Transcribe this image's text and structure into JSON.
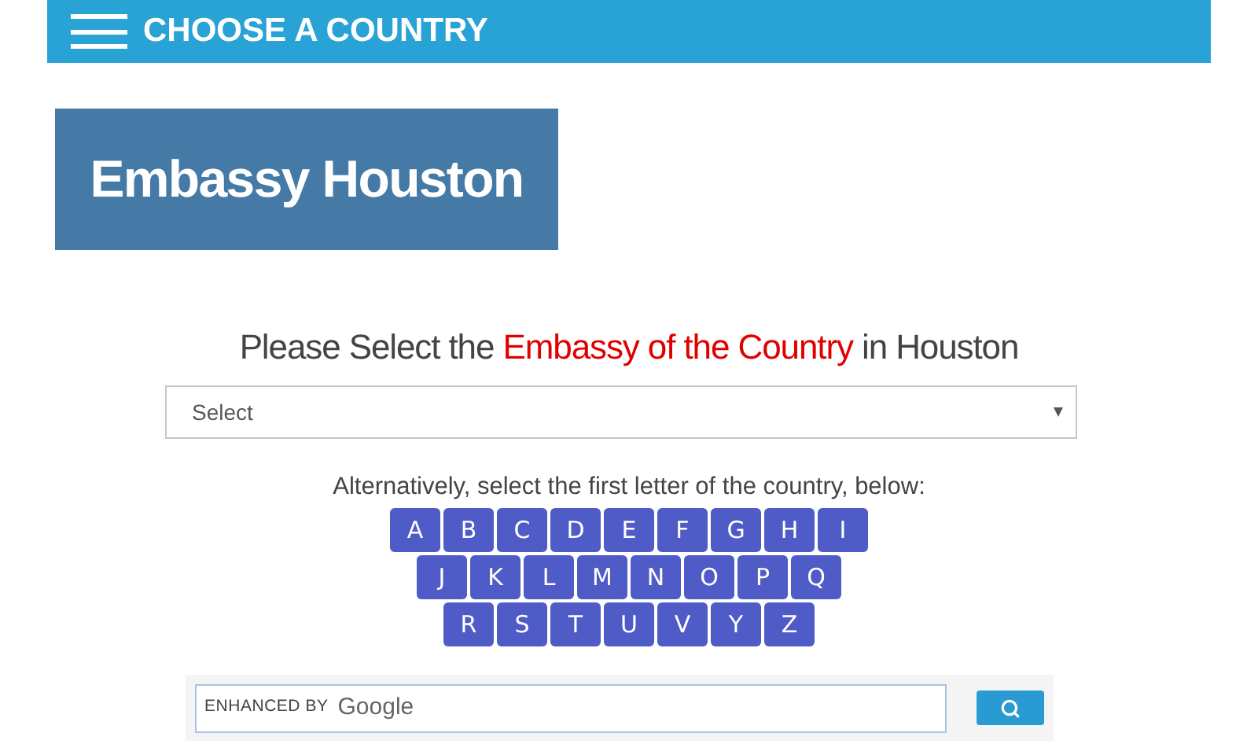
{
  "header": {
    "title": "CHOOSE A COUNTRY"
  },
  "banner": {
    "title": "Embassy Houston"
  },
  "prompt": [
    {
      "text": "Please Select the",
      "highlight": false
    },
    {
      "text": "Embassy of the Country",
      "highlight": true
    },
    {
      "text": "in Houston",
      "highlight": false
    }
  ],
  "select": {
    "value": "Select"
  },
  "alternative_text": "Alternatively, select the first letter of the country, below:",
  "letter_rows": [
    [
      "A",
      "B",
      "C",
      "D",
      "E",
      "F",
      "G",
      "H",
      "I"
    ],
    [
      "J",
      "K",
      "L",
      "M",
      "N",
      "O",
      "P",
      "Q"
    ],
    [
      "R",
      "S",
      "T",
      "U",
      "V",
      "Y",
      "Z"
    ]
  ],
  "search": {
    "prefix": "ENHANCED BY",
    "brand": "Google"
  }
}
